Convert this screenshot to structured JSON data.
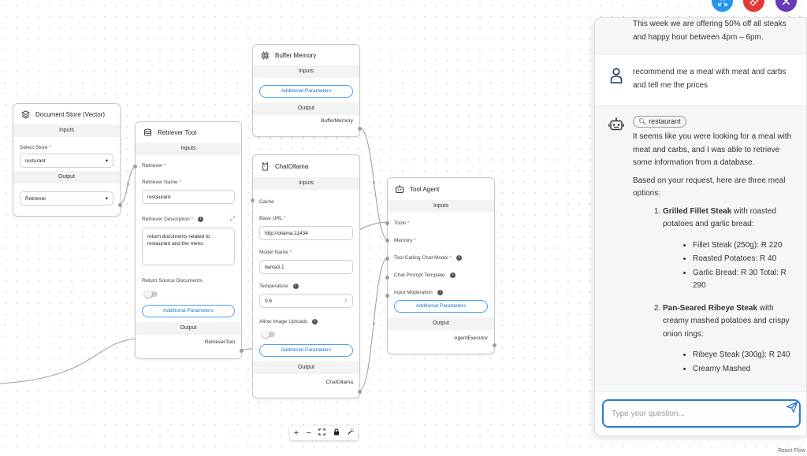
{
  "nodes": {
    "document_store": {
      "title": "Document Store (Vector)",
      "inputs_label": "Inputs",
      "select_store_label": "Select Store",
      "select_store_value": "resturant",
      "output_label": "Output",
      "output_value": "Retriever"
    },
    "retriever_tool": {
      "title": "Retriever Tool",
      "inputs_label": "Inputs",
      "retriever_label": "Retriever",
      "name_label": "Retriever Name",
      "name_value": "restaurant",
      "description_label": "Retriever Description",
      "description_value": "return documents related to restaurant and the menu",
      "return_source_label": "Return Source Documents",
      "additional_params": "Additional Parameters",
      "output_label": "Output",
      "output_value": "RetrieverTool"
    },
    "buffer_memory": {
      "title": "Buffer Memory",
      "inputs_label": "Inputs",
      "additional_params": "Additional Parameters",
      "output_label": "Output",
      "output_value": "BufferMemory"
    },
    "chat_ollama": {
      "title": "ChatOllama",
      "inputs_label": "Inputs",
      "cache_label": "Cache",
      "base_url_label": "Base URL",
      "base_url_value": "http://ollama:11434",
      "model_name_label": "Model Name",
      "model_name_value": "llama3.1",
      "temperature_label": "Temperature",
      "temperature_value": "0.6",
      "allow_uploads_label": "Allow Image Uploads",
      "additional_params": "Additional Parameters",
      "output_label": "Output",
      "output_value": "ChatOllama"
    },
    "tool_agent": {
      "title": "Tool Agent",
      "inputs_label": "Inputs",
      "tools_label": "Tools",
      "memory_label": "Memory",
      "tool_calling_label": "Tool Calling Chat Model",
      "prompt_template_label": "Chat Prompt Template",
      "input_moderation_label": "Input Moderation",
      "additional_params": "Additional Parameters",
      "output_label": "Output",
      "output_value": "AgentExecutor"
    }
  },
  "chat": {
    "prev_bot_text": "This week we are offering 50% off all steaks and happy hour between 4pm – 6pm.",
    "user_text": "recommend me a meal with meat and carbs and tell me the prices",
    "tool_chip": "restaurant",
    "bot_intro": "It seems like you were looking for a meal with meat and carbs, and I was able to retrieve some information from a database.",
    "bot_lead": "Based on your request, here are three meal options:",
    "meal1_name": "Grilled Fillet Steak",
    "meal1_desc": " with roasted potatoes and garlic bread:",
    "meal1_items": [
      "Fillet Steak (250g): R 220",
      "Roasted Potatoes: R 40",
      "Garlic Bread: R 30 Total: R 290"
    ],
    "meal2_name": "Pan-Seared Ribeye Steak",
    "meal2_desc": " with creamy mashed potatoes and crispy onion rings:",
    "meal2_items": [
      "Ribeye Steak (300g): R 240",
      "Creamy Mashed"
    ],
    "input_placeholder": "Type your question..."
  },
  "controls": {
    "zoom_in": "+",
    "zoom_out": "−"
  },
  "attribution": "React Flow",
  "colors": {
    "fab_blue": "#2196f3",
    "fab_red": "#e53935",
    "fab_purple": "#673ab7",
    "accent": "#2b7bd0"
  }
}
